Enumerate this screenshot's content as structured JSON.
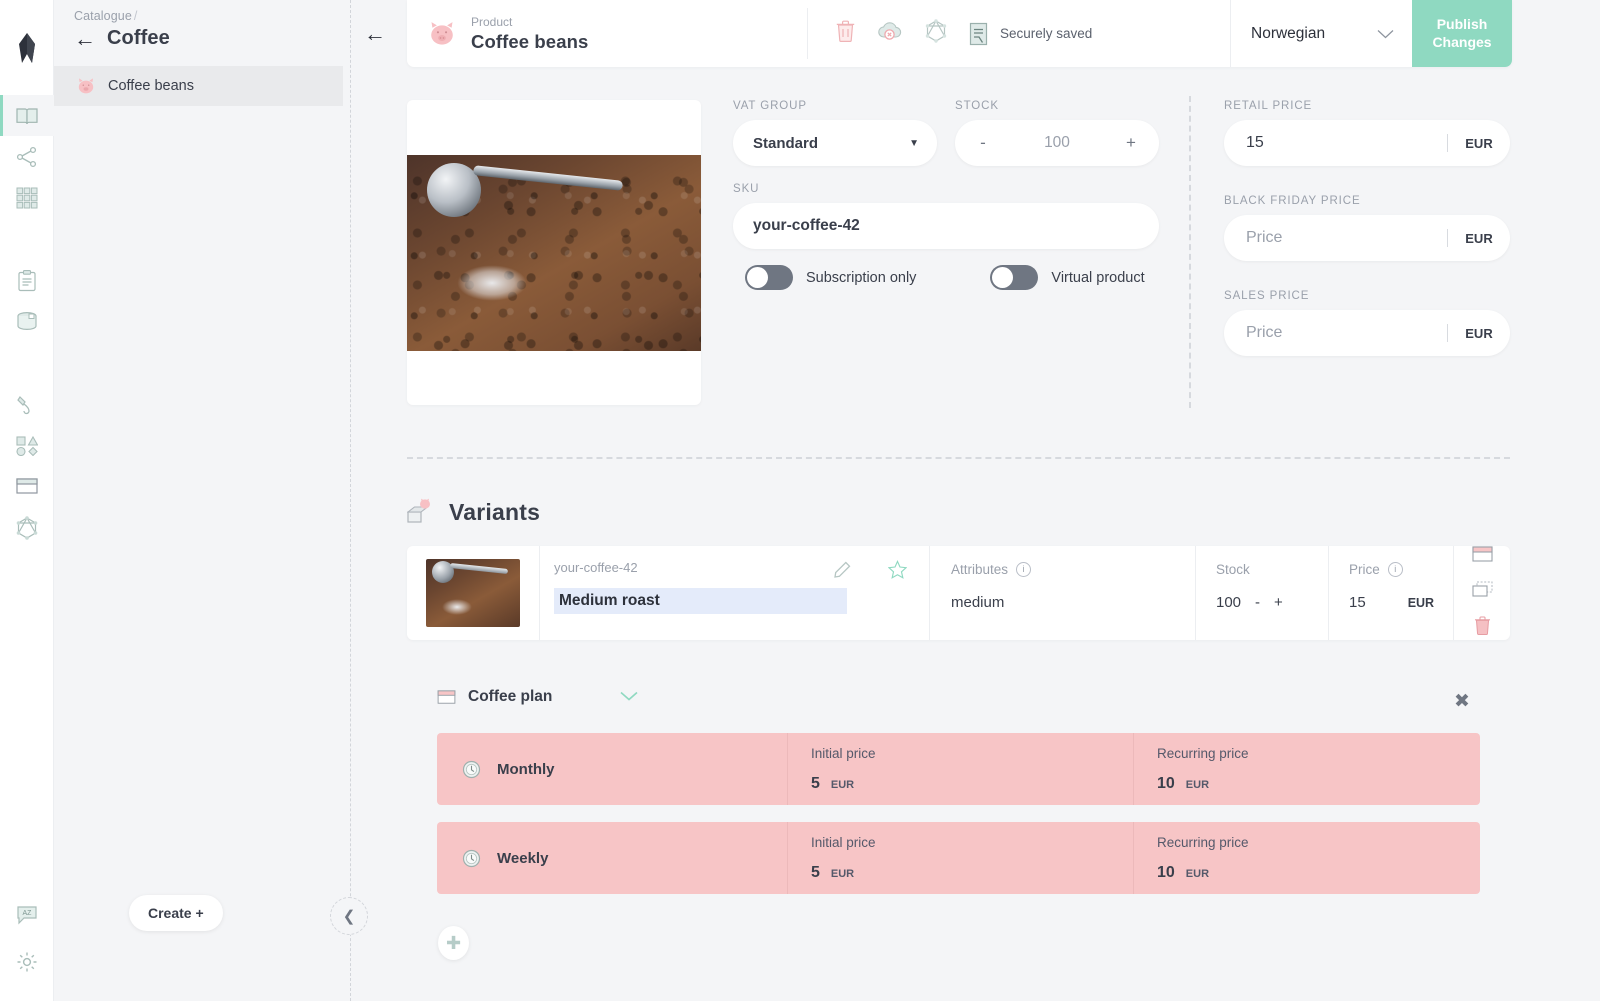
{
  "brand": {
    "logo_icon": "crystl-logo-icon"
  },
  "rail": {
    "items": [
      {
        "name": "catalogue",
        "icon": "open-book-icon",
        "active": true
      },
      {
        "name": "topology",
        "icon": "share-nodes-icon",
        "active": false
      },
      {
        "name": "grid",
        "icon": "grid-icon",
        "active": false
      },
      {
        "name": "documents",
        "icon": "clipboard-icon",
        "active": false
      },
      {
        "name": "orders",
        "icon": "box-3d-icon",
        "active": false
      },
      {
        "name": "pipelines",
        "icon": "paint-icon",
        "active": false
      },
      {
        "name": "shapes",
        "icon": "shapes-icon",
        "active": false
      },
      {
        "name": "subscriptions",
        "icon": "plan-card-icon",
        "active": false
      },
      {
        "name": "graphql",
        "icon": "graphql-icon",
        "active": false
      }
    ],
    "bottom_items": [
      {
        "name": "translations",
        "icon": "translate-bubble-icon"
      },
      {
        "name": "settings",
        "icon": "gear-icon"
      }
    ]
  },
  "catalogue": {
    "breadcrumb": "Catalogue",
    "breadcrumb_separator": "/",
    "title": "Coffee",
    "back_icon": "arrow-left-icon",
    "items": [
      {
        "label": "Coffee beans",
        "icon": "pig-icon",
        "selected": true
      }
    ],
    "create_label": "Create +",
    "collapse_icon": "chevron-left-icon"
  },
  "topbar": {
    "back_icon": "arrow-left-icon",
    "product_icon": "pig-icon",
    "meta_label": "Product",
    "title": "Coffee beans",
    "actions": [
      {
        "name": "delete",
        "icon": "trash-icon"
      },
      {
        "name": "unpublish",
        "icon": "cloud-x-icon"
      },
      {
        "name": "graphql",
        "icon": "graphql-icon"
      },
      {
        "name": "document",
        "icon": "form-doc-icon"
      }
    ],
    "status": "Securely saved",
    "language": "Norwegian",
    "language_caret_icon": "chevron-down-icon",
    "publish_label": "Publish Changes"
  },
  "form": {
    "vat": {
      "label": "VAT GROUP",
      "value": "Standard",
      "caret_icon": "caret-down-icon"
    },
    "stock": {
      "label": "STOCK",
      "value": "100",
      "minus": "-",
      "plus": "+"
    },
    "sku": {
      "label": "SKU",
      "value": "your-coffee-42"
    },
    "toggles": [
      {
        "label": "Subscription only",
        "on": false
      },
      {
        "label": "Virtual product",
        "on": false
      }
    ],
    "prices": [
      {
        "label": "RETAIL PRICE",
        "value": "15",
        "placeholder": false,
        "currency": "EUR"
      },
      {
        "label": "BLACK FRIDAY PRICE",
        "value": "Price",
        "placeholder": true,
        "currency": "EUR"
      },
      {
        "label": "SALES PRICE",
        "value": "Price",
        "placeholder": true,
        "currency": "EUR"
      }
    ]
  },
  "variants": {
    "section_icon": "variants-icon",
    "section_title": "Variants",
    "columns": {
      "attributes": "Attributes",
      "stock": "Stock",
      "price": "Price"
    },
    "row": {
      "sku": "your-coffee-42",
      "name": "Medium roast",
      "attributes": "medium",
      "stock": "100",
      "stock_minus": "-",
      "stock_plus": "+",
      "price": "15",
      "currency": "EUR",
      "edit_icon": "pencil-icon",
      "star_icon": "star-icon",
      "action_icons": [
        {
          "name": "subscription-plan",
          "icon": "plan-card-icon"
        },
        {
          "name": "duplicate",
          "icon": "duplicate-icon"
        },
        {
          "name": "delete-variant",
          "icon": "trash-icon"
        }
      ]
    }
  },
  "plan": {
    "icon": "plan-card-icon",
    "name": "Coffee plan",
    "chevron_icon": "chevron-down-icon",
    "close_icon": "close-icon",
    "rows": [
      {
        "name": "Monthly",
        "icon": "clock-icon",
        "initial_label": "Initial price",
        "initial_value": "5",
        "initial_currency": "EUR",
        "recurring_label": "Recurring price",
        "recurring_value": "10",
        "recurring_currency": "EUR"
      },
      {
        "name": "Weekly",
        "icon": "clock-icon",
        "initial_label": "Initial price",
        "initial_value": "5",
        "initial_currency": "EUR",
        "recurring_label": "Recurring price",
        "recurring_value": "10",
        "recurring_currency": "EUR"
      }
    ],
    "add_icon": "plus-icon"
  },
  "colors": {
    "accent_green": "#8fd9c1",
    "accent_pink": "#f7c5c6",
    "page_bg": "#f4f5f7",
    "text": "#3a3f4b",
    "muted": "#9aa0ab",
    "highlight_blue": "#e4ebfa"
  }
}
